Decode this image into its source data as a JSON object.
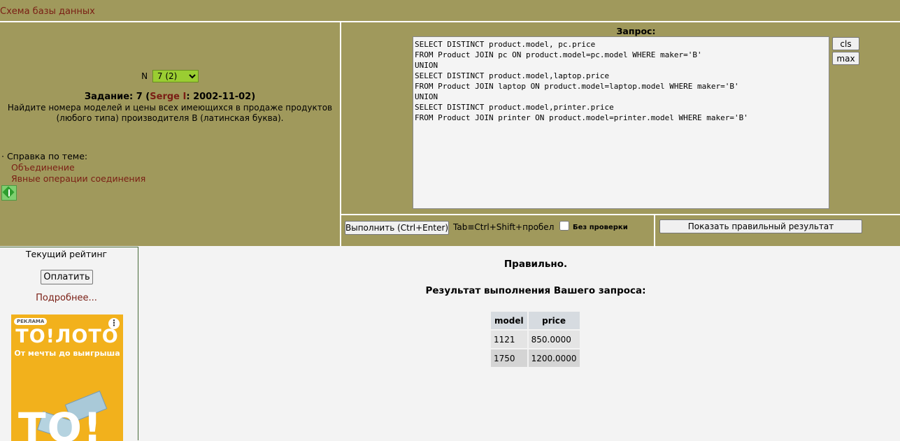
{
  "topbar": {
    "schema_link": "Схема базы данных"
  },
  "task": {
    "n_label": "N",
    "n_selected": "7 (2)",
    "title_prefix": "Задание: 7 (",
    "author": "Serge I",
    "title_suffix": ": 2002-11-02)",
    "text": "Найдите номера моделей и цены всех имеющихся в продаже продуктов (любого типа) производителя B (латинская буква)."
  },
  "help": {
    "heading": "· Справка по теме:",
    "links": [
      "Объединение",
      "Явные операции соединения"
    ]
  },
  "query": {
    "label": "Запрос:",
    "text": "SELECT DISTINCT product.model, pc.price\nFROM Product JOIN pc ON product.model=pc.model WHERE maker='B'\nUNION\nSELECT DISTINCT product.model,laptop.price\nFROM Product JOIN laptop ON product.model=laptop.model WHERE maker='B'\nUNION\nSELECT DISTINCT product.model,printer.price\nFROM Product JOIN printer ON product.model=printer.model WHERE maker='B'",
    "cls_label": "cls",
    "max_label": "max"
  },
  "run_row": {
    "run_label": "Выполнить (Ctrl+Enter)",
    "tab_hint": "Tab≡Ctrl+Shift+пробел",
    "nocheck_label": "Без проверки",
    "show_result_label": "Показать правильный результат"
  },
  "sidebar": {
    "rating_label": "Текущий рейтинг",
    "pay_label": "Оплатить",
    "more_label": "Подробнее..."
  },
  "ad": {
    "badge": "РЕКЛАМА",
    "logo": "ТО!ЛОТО",
    "slogan": "От мечты до выигрыша",
    "big_text": "ТО!"
  },
  "result": {
    "status": "Правильно.",
    "title": "Результат выполнения Вашего запроса:",
    "columns": [
      "model",
      "price"
    ],
    "rows": [
      [
        "1121",
        "850.0000"
      ],
      [
        "1750",
        "1200.0000"
      ]
    ]
  },
  "colors": {
    "panel_bg": "#a0995c",
    "link": "#7a1e14",
    "select_bg": "#9acd32",
    "ad_bg": "#f2b11c"
  }
}
